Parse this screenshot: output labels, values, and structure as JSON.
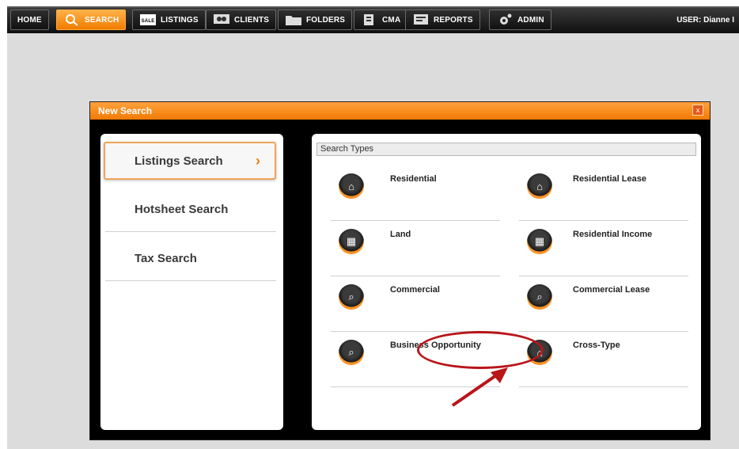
{
  "nav": {
    "items": [
      {
        "label": "HOME",
        "icon": "home",
        "active": false
      },
      {
        "label": "SEARCH",
        "icon": "magnifier-icon",
        "active": true
      },
      {
        "label": "LISTINGS",
        "icon": "for-sale-sign-icon",
        "active": false
      },
      {
        "label": "CLIENTS",
        "icon": "clients-icon",
        "active": false
      },
      {
        "label": "FOLDERS",
        "icon": "folder-icon",
        "active": false
      },
      {
        "label": "CMA",
        "icon": "cma-icon",
        "active": false
      },
      {
        "label": "REPORTS",
        "icon": "reports-icon",
        "active": false
      },
      {
        "label": "ADMIN",
        "icon": "gear-icon",
        "active": false
      }
    ],
    "user": "USER: Dianne I"
  },
  "modal": {
    "title": "New Search",
    "close": "x"
  },
  "left_menu": {
    "items": [
      {
        "label": "Listings Search",
        "selected": true
      },
      {
        "label": "Hotsheet Search",
        "selected": false
      },
      {
        "label": "Tax Search",
        "selected": false
      }
    ],
    "selected_chevron": "›"
  },
  "search_types": {
    "header": "Search Types",
    "items": [
      {
        "label": "Residential",
        "icon": "house-search-icon"
      },
      {
        "label": "Residential Lease",
        "icon": "house-search-icon"
      },
      {
        "label": "Land",
        "icon": "building-icon"
      },
      {
        "label": "Residential Income",
        "icon": "building-icon"
      },
      {
        "label": "Commercial",
        "icon": "land-search-icon"
      },
      {
        "label": "Commercial Lease",
        "icon": "land-search-icon"
      },
      {
        "label": "Business Opportunity",
        "icon": "land-search-icon"
      },
      {
        "label": "Cross-Type",
        "icon": "house-search-icon"
      }
    ]
  },
  "colors": {
    "accent": "#f07a05",
    "annotation": "#b8151a"
  }
}
